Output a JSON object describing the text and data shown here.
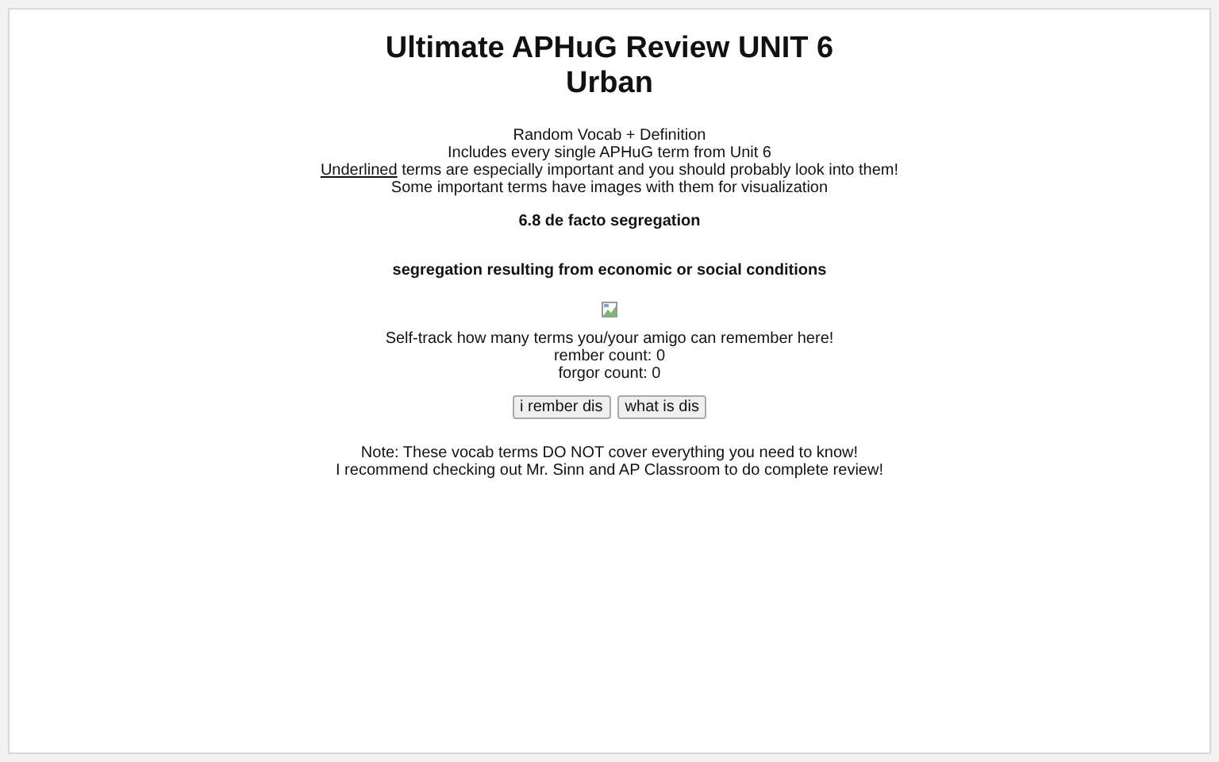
{
  "title_lines": [
    "Ultimate APHuG Review UNIT 6",
    "Urban"
  ],
  "intro": {
    "line_1": "Random Vocab + Definition",
    "line_2": "Includes every single APHuG term from Unit 6",
    "line_3_underlined": "Underlined",
    "line_3_rest": " terms are especially important and you should probably look into them!",
    "line_4": "Some important terms have images with them for visualization"
  },
  "term": "6.8 de facto segregation",
  "definition": "segregation resulting from economic or social conditions",
  "tracker": {
    "prompt": "Self-track how many terms you/your amigo can remember here!",
    "rember_count": "rember count: 0",
    "forgor_count": "forgor count: 0"
  },
  "buttons": [
    "i rember dis",
    "what is dis"
  ],
  "notes": [
    "Note: These vocab terms DO NOT cover everything you need to know!",
    "I recommend checking out Mr. Sinn and AP Classroom to do complete review!"
  ]
}
